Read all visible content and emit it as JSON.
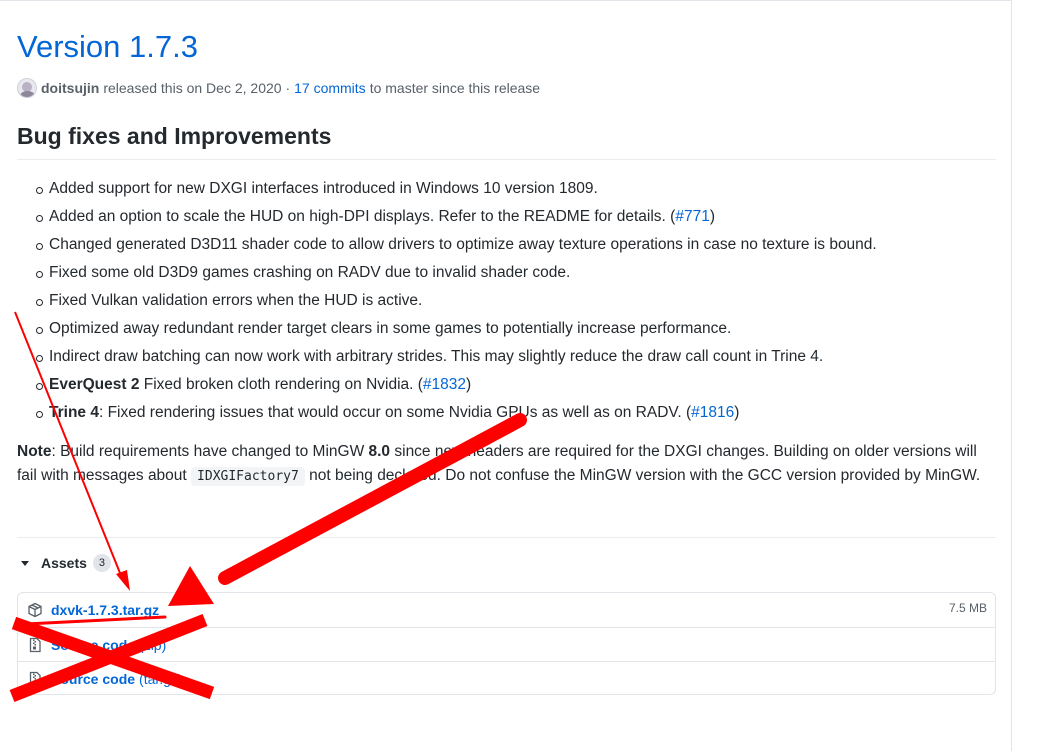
{
  "release": {
    "title": "Version 1.7.3",
    "author": "doitsujin",
    "released_text": "released this on Dec 2, 2020 ·",
    "commits_link": "17 commits",
    "commits_suffix": "to master since this release"
  },
  "section_title": "Bug fixes and Improvements",
  "bugs": {
    "items": [
      {
        "text": "Added support for new DXGI interfaces introduced in Windows 10 version 1809."
      },
      {
        "text": "Added an option to scale the HUD on high-DPI displays. Refer to the README for details. (",
        "issue": "#771",
        "after": ")"
      },
      {
        "text": "Changed generated D3D11 shader code to allow drivers to optimize away texture operations in case no texture is bound."
      },
      {
        "text": "Fixed some old D3D9 games crashing on RADV due to invalid shader code."
      },
      {
        "text": "Fixed Vulkan validation errors when the HUD is active."
      },
      {
        "text": "Optimized away redundant render target clears in some games to potentially increase performance."
      },
      {
        "text": "Indirect draw batching can now work with arbitrary strides. This may slightly reduce the draw call count in Trine 4."
      },
      {
        "bold": "EverQuest 2",
        "text": " Fixed broken cloth rendering on Nvidia. (",
        "issue": "#1832",
        "after": ")"
      },
      {
        "bold": "Trine 4",
        "text": ": Fixed rendering issues that would occur on some Nvidia GPUs as well as on RADV. (",
        "issue": "#1816",
        "after": ")"
      }
    ]
  },
  "note": {
    "label": "Note",
    "part1": ": Build requirements have changed to MinGW ",
    "version": "8.0",
    "part2": " since new headers are required for the DXGI changes. Building on older versions will fail with messages about ",
    "code": "IDXGIFactory7",
    "part3": " not being declared. Do not confuse the MinGW version with the GCC version provided by MinGW."
  },
  "assets": {
    "label": "Assets",
    "count": "3",
    "items": [
      {
        "name": "dxvk-1.7.3.tar.gz",
        "note": "",
        "size": "7.5 MB",
        "icon": "package-icon"
      },
      {
        "name": "Source code",
        "note": "(zip)",
        "size": "",
        "icon": "file-zip-icon"
      },
      {
        "name": "Source code",
        "note": "(tar.gz)",
        "size": "",
        "icon": "file-zip-icon"
      }
    ]
  },
  "annotation_color": "#ff0000"
}
